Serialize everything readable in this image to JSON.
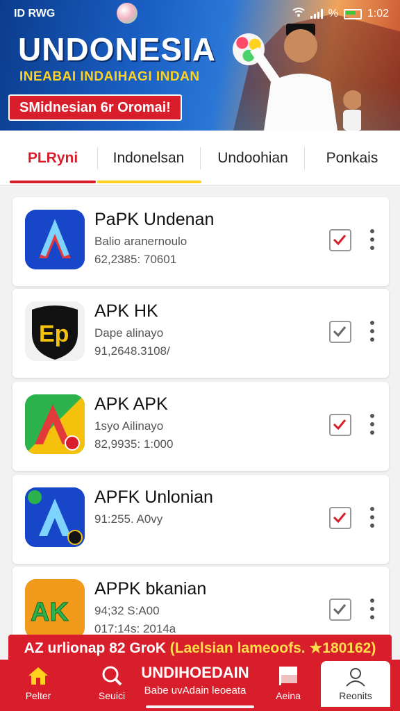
{
  "status_bar": {
    "carrier": "ID RWG",
    "battery_pct": "%",
    "time": "1:02"
  },
  "banner": {
    "title": "UNDONESIA",
    "subtitle": "INEABAI INDAIHAGI INDAN",
    "promo": "SMidnesian 6r Oromai!"
  },
  "tabs": [
    {
      "label": "PLRyni",
      "active": true,
      "underline_color": "#d81e2a"
    },
    {
      "label": "Indonelsan",
      "active": false,
      "underline_color": "#ffd21f"
    },
    {
      "label": "Undoohian",
      "active": false
    },
    {
      "label": "Ponkais",
      "active": false
    }
  ],
  "apps": [
    {
      "name": "PaPK Undenan",
      "line1": "Balio aranernoulo",
      "line2": "62,2385: 70601",
      "checked": true,
      "check_color": "#d81e2a"
    },
    {
      "name": "APK HK",
      "line1": "Dape alinayo",
      "line2": "91,2648.3108/",
      "checked": true,
      "check_color": "#666666"
    },
    {
      "name": "APK APK",
      "line1": "1syo Ailinayo",
      "line2": "82,9935: 1:000",
      "checked": true,
      "check_color": "#d81e2a"
    },
    {
      "name": "APFK Unlonian",
      "line1": "91:255. A0vy",
      "line2": "",
      "checked": true,
      "check_color": "#d81e2a"
    },
    {
      "name": "APPK bkanian",
      "line1": "94;32 S:A00",
      "line2": "017:14s: 2014a",
      "checked": true,
      "check_color": "#666666"
    }
  ],
  "promo_bar": {
    "text": "AZ urlionap 82 GroK",
    "highlight": "(Laelsian lameoofs. ★180162)"
  },
  "bottom_nav": {
    "items": [
      {
        "label": "Pelter",
        "icon": "home-icon"
      },
      {
        "label": "Seuici",
        "icon": "search-icon"
      },
      {
        "label": "Aeina",
        "icon": "flag-icon"
      },
      {
        "label": "Reonits",
        "icon": "profile-icon"
      }
    ],
    "center_title": "UNDIHOEDAIN",
    "center_sub": "Babe uvAdain leoeata"
  },
  "colors": {
    "brand_red": "#d81e2a",
    "accent_yellow": "#ffd21f"
  }
}
